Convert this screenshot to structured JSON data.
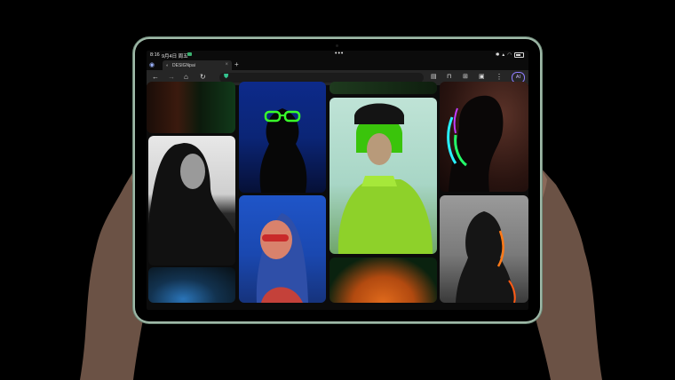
{
  "status": {
    "time": "8:16",
    "date": "9月4日 周五"
  },
  "browser": {
    "tab_title": "DESIGNpai",
    "new_tab": "+",
    "close": "×",
    "back": "←",
    "forward": "→",
    "home": "⌂",
    "reload": "↻",
    "ai_label": "AI",
    "menu": "⋮"
  },
  "gallery": {
    "items": [
      {
        "name": "portrait-dark-hair-bw"
      },
      {
        "name": "silhouette-green-glasses"
      },
      {
        "name": "portrait-red-sunglasses-blue"
      },
      {
        "name": "portrait-green-bob"
      },
      {
        "name": "silhouette-neon-profile"
      },
      {
        "name": "silhouette-orange-rim"
      }
    ]
  },
  "colors": {
    "frame": "#9fb9a8",
    "accent_green": "#34c38f",
    "ai_purple": "#8f7cff"
  }
}
